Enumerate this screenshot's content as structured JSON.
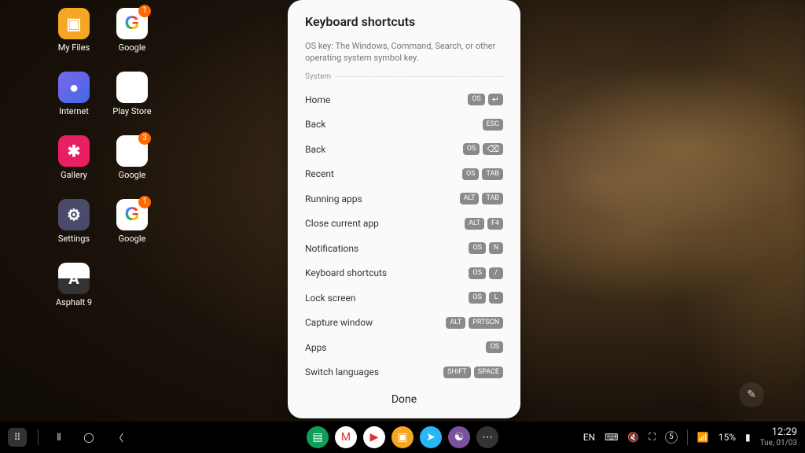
{
  "desktop": {
    "icons": [
      {
        "label": "My Files",
        "kind": "myfiles",
        "badge": null
      },
      {
        "label": "Google",
        "kind": "google",
        "badge": "1"
      },
      {
        "label": "Internet",
        "kind": "internet",
        "badge": null
      },
      {
        "label": "Play Store",
        "kind": "playstore",
        "badge": null
      },
      {
        "label": "Gallery",
        "kind": "gallery",
        "badge": null
      },
      {
        "label": "Google",
        "kind": "gfolder",
        "badge": "3"
      },
      {
        "label": "Settings",
        "kind": "settings",
        "badge": null
      },
      {
        "label": "Google",
        "kind": "google",
        "badge": "1"
      },
      {
        "label": "Asphalt 9",
        "kind": "asphalt",
        "badge": null
      }
    ]
  },
  "modal": {
    "title": "Keyboard shortcuts",
    "subtitle": "OS key: The Windows, Command, Search, or other operating system symbol key.",
    "section": "System",
    "rows": [
      {
        "label": "Home",
        "keys": [
          "OS",
          "↵"
        ]
      },
      {
        "label": "Back",
        "keys": [
          "ESC"
        ]
      },
      {
        "label": "Back",
        "keys": [
          "OS",
          "⌫"
        ]
      },
      {
        "label": "Recent",
        "keys": [
          "OS",
          "TAB"
        ]
      },
      {
        "label": "Running apps",
        "keys": [
          "ALT",
          "TAB"
        ]
      },
      {
        "label": "Close current app",
        "keys": [
          "ALT",
          "F4"
        ]
      },
      {
        "label": "Notifications",
        "keys": [
          "OS",
          "N"
        ]
      },
      {
        "label": "Keyboard shortcuts",
        "keys": [
          "OS",
          "/"
        ]
      },
      {
        "label": "Lock screen",
        "keys": [
          "OS",
          "L"
        ]
      },
      {
        "label": "Capture window",
        "keys": [
          "ALT",
          "PRTSCN"
        ]
      },
      {
        "label": "Apps",
        "keys": [
          "OS"
        ]
      },
      {
        "label": "Switch languages",
        "keys": [
          "SHIFT",
          "SPACE"
        ]
      }
    ],
    "done": "Done"
  },
  "taskbar": {
    "lang": "EN",
    "battery_pct": "15%",
    "notif_count": "5",
    "time": "12:29",
    "date": "Tue, 01/03",
    "wifi_icon": "▾",
    "center_apps": [
      "sheets",
      "gmail",
      "play",
      "files",
      "telegram",
      "viber",
      "more"
    ]
  }
}
